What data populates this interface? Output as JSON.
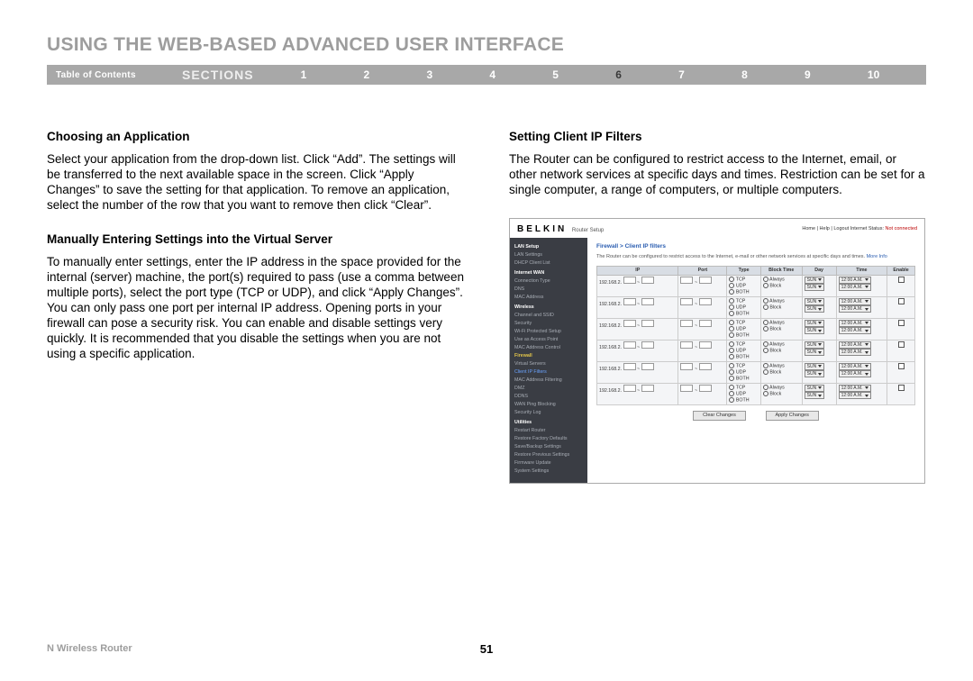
{
  "header": {
    "title": "USING THE WEB-BASED ADVANCED USER INTERFACE"
  },
  "nav": {
    "toc": "Table of Contents",
    "sections_label": "SECTIONS",
    "nums": [
      "1",
      "2",
      "3",
      "4",
      "5",
      "6",
      "7",
      "8",
      "9",
      "10"
    ],
    "active": "6"
  },
  "left_col": {
    "h1": "Choosing an Application",
    "p1": "Select your application from the drop-down list. Click “Add”. The settings will be transferred to the next available space in the screen. Click “Apply Changes” to save the setting for that application. To remove an application, select the number of the row that you want to remove then click “Clear”.",
    "h2": "Manually Entering Settings into the Virtual Server",
    "p2": "To manually enter settings, enter the IP address in the space provided for the internal (server) machine, the port(s) required to pass (use a comma between multiple ports), select the port type (TCP or UDP), and click “Apply Changes”. You can only pass one port per internal IP address. Opening ports in your firewall can pose a security risk. You can enable and disable settings very quickly. It is recommended that you disable the settings when you are not using a specific application."
  },
  "right_col": {
    "h1": "Setting Client IP Filters",
    "p1": "The Router can be configured to restrict access to the Internet, email, or other network services at specific days and times. Restriction can be set for a single computer, a range of computers, or multiple computers."
  },
  "router": {
    "brand": "BELKIN",
    "brand_sub": "Router Setup",
    "toplinks": "Home | Help | Logout   Internet Status:",
    "status": "Not connected",
    "crumb": "Firewall > Client IP filters",
    "desc": "The Router can be configured to restrict access to the Internet, e-mail or other network services at specific days and times.",
    "more": "More Info",
    "side": {
      "lan": "LAN Setup",
      "lan_items": [
        "LAN Settings",
        "DHCP Client List"
      ],
      "wan": "Internet WAN",
      "wan_items": [
        "Connection Type",
        "DNS",
        "MAC Address"
      ],
      "wl": "Wireless",
      "wl_items": [
        "Channel and SSID",
        "Security",
        "Wi-Fi Protected Setup",
        "Use as Access Point",
        "MAC Address Control"
      ],
      "fw": "Firewall",
      "fw_items_a": "Virtual Servers",
      "fw_items_b": "Client IP Filters",
      "fw_items_c": [
        "MAC Address Filtering",
        "DMZ",
        "DDNS",
        "WAN Ping Blocking",
        "Security Log"
      ],
      "ut": "Utilities",
      "ut_items": [
        "Restart Router",
        "Restore Factory Defaults",
        "Save/Backup Settings",
        "Restore Previous Settings",
        "Firmware Update",
        "System Settings"
      ]
    },
    "headers": [
      "IP",
      "Port",
      "Type",
      "Block Time",
      "Day",
      "Time",
      "Enable"
    ],
    "ip_prefix": "192.168.2.",
    "types": [
      "TCP",
      "UDP",
      "BOTH"
    ],
    "bt": [
      "Always",
      "Block"
    ],
    "day": "SUN",
    "time": "12:00 A.M.",
    "btn_clear": "Clear Changes",
    "btn_apply": "Apply Changes"
  },
  "footer": {
    "left": "N Wireless Router",
    "page": "51"
  }
}
